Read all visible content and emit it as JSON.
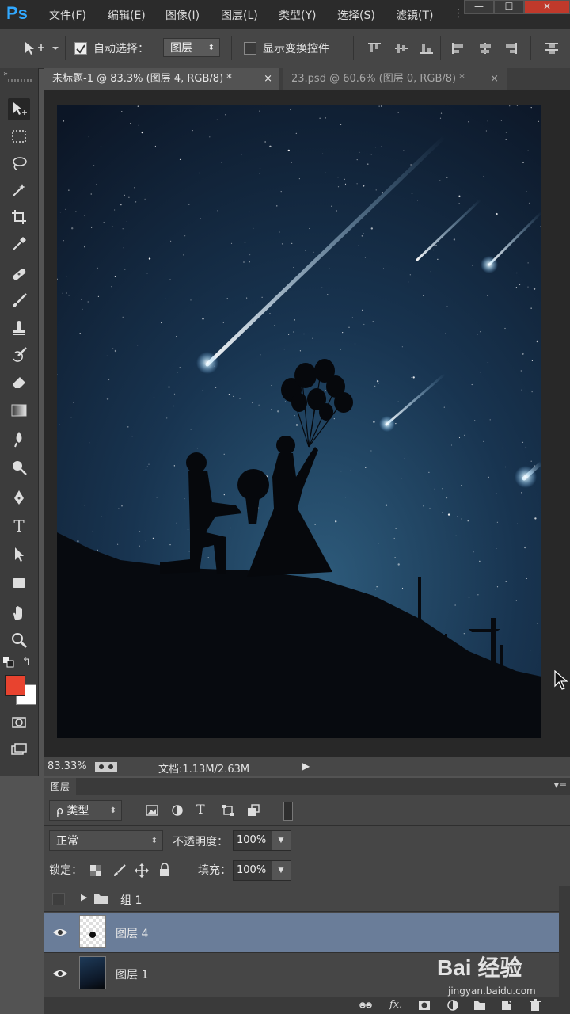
{
  "app": {
    "logo": "Ps"
  },
  "menu": [
    "文件(F)",
    "编辑(E)",
    "图像(I)",
    "图层(L)",
    "类型(Y)",
    "选择(S)",
    "滤镜(T)"
  ],
  "window_buttons": {
    "minimize": "—",
    "maximize": "☐",
    "close": "✕"
  },
  "options": {
    "auto_select_label": "自动选择：",
    "auto_select_value": "图层",
    "show_transform_label": "显示变换控件"
  },
  "tabs": [
    {
      "label": "未标题-1 @ 83.3% (图层 4, RGB/8) *",
      "close": "×"
    },
    {
      "label": "23.psd @ 60.6% (图层 0, RGB/8) *",
      "close": "×"
    }
  ],
  "tools": [
    "move-icon",
    "marquee-icon",
    "lasso-icon",
    "magic-wand-icon",
    "crop-icon",
    "eyedropper-icon",
    "healing-brush-icon",
    "brush-icon",
    "clone-stamp-icon",
    "history-brush-icon",
    "eraser-icon",
    "gradient-icon",
    "blur-icon",
    "dodge-icon",
    "pen-icon",
    "type-icon",
    "path-selection-icon",
    "rectangle-icon",
    "hand-icon",
    "zoom-icon"
  ],
  "colors": {
    "foreground": "#e8432f",
    "background": "#ffffff",
    "accent": "#31a8ff",
    "selected_layer": "#6a7d99"
  },
  "status": {
    "zoom": "83.33%",
    "document": "文档:1.13M/2.63M"
  },
  "layers_panel": {
    "title": "图层",
    "filter_kind": "ρ 类型",
    "blend_mode": "正常",
    "opacity_label": "不透明度：",
    "opacity_value": "100%",
    "lock_label": "锁定：",
    "fill_label": "填充：",
    "fill_value": "100%",
    "layers": [
      {
        "name": "组 1",
        "type": "group",
        "visible": false,
        "selected": false
      },
      {
        "name": "图层 4",
        "type": "layer",
        "visible": true,
        "selected": true
      },
      {
        "name": "图层 1",
        "type": "layer",
        "visible": true,
        "selected": false
      }
    ]
  },
  "watermark": {
    "brand": "Bai 经验",
    "url": "jingyan.baidu.com"
  }
}
